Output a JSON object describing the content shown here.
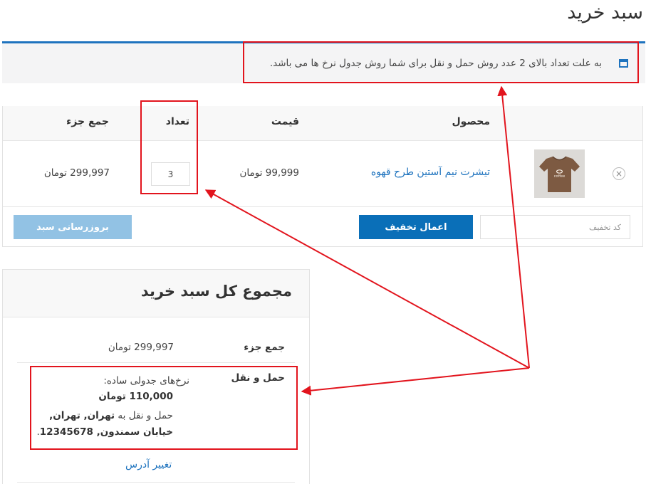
{
  "page": {
    "title": "سبد خرید"
  },
  "notice": {
    "message": "به علت تعداد بالای 2 عدد روش حمل و نقل برای شما روش جدول نرخ ها می باشد."
  },
  "cart": {
    "headers": {
      "product": "محصول",
      "price": "قیمت",
      "quantity": "تعداد",
      "subtotal": "جمع جزء"
    },
    "item": {
      "remove": "×",
      "name": "تیشرت نیم آستین طرح قهوه",
      "image_text": "coffee",
      "price": "99,999 تومان",
      "quantity": "3",
      "subtotal": "299,997 تومان"
    },
    "coupon_placeholder": "کد تخفیف",
    "apply_coupon": "اعمال تخفیف",
    "update_cart": "بروزرسانی سبد"
  },
  "totals": {
    "title": "مجموع کل سبد خرید",
    "subtotal_label": "جمع جزء",
    "subtotal_value": "299,997 تومان",
    "shipping_label": "حمل و نقل",
    "shipping_method": "نرخ‌های جدولی ساده:",
    "shipping_cost": "110,000 تومان",
    "shipping_to_prefix": "حمل و نقل به",
    "shipping_address_1": "تهران, تهران,",
    "shipping_address_2": "خیابان سمندون, 12345678",
    "shipping_address_end": ".",
    "change_address": "تغییر آدرس"
  },
  "colors": {
    "accent": "#1e73be",
    "apply_button": "#0a6fb8",
    "update_button": "#92c2e4",
    "annotation": "#e2141d",
    "shirt": "#7d5a42"
  }
}
